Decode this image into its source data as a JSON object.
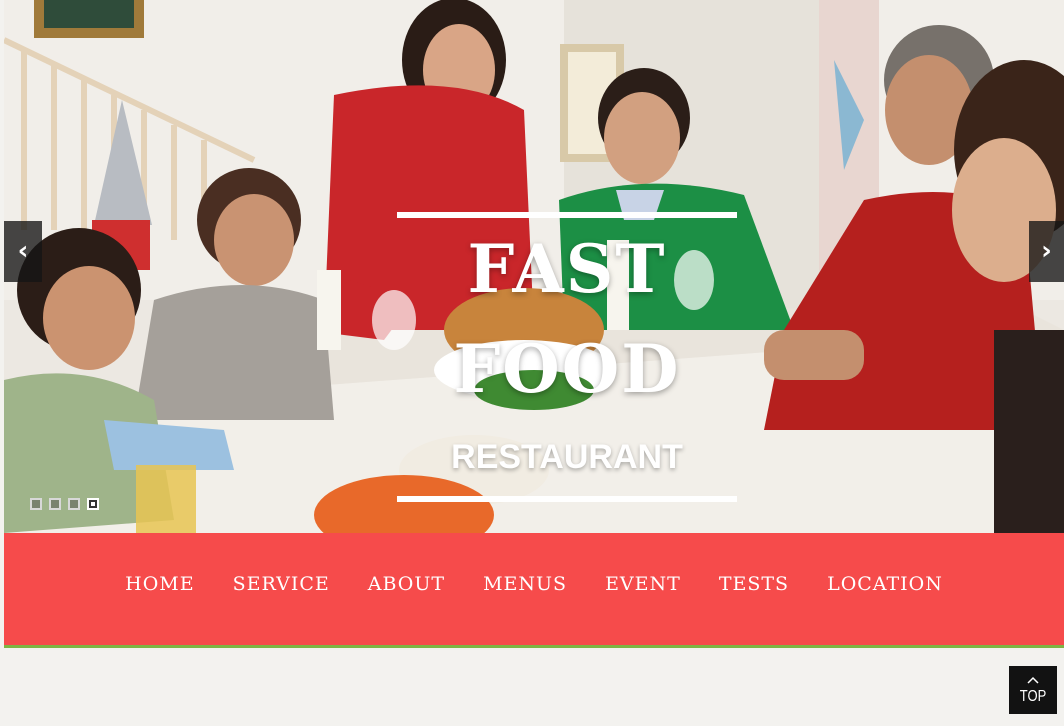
{
  "slider": {
    "title_line1": "FAST",
    "title_line2": "FOOD",
    "subtitle": "RESTAURANT",
    "prev_icon": "‹",
    "next_icon": "›",
    "slides_total": 4,
    "active_slide": 4
  },
  "nav": {
    "items": [
      "HOME",
      "SERVICE",
      "ABOUT",
      "MENUS",
      "EVENT",
      "TESTS",
      "LOCATION"
    ]
  },
  "back_to_top": {
    "label": "TOP"
  },
  "colors": {
    "nav_bg": "#f64b4b",
    "nav_border": "#7eb444",
    "page_bg": "#f3f2ef",
    "top_button_bg": "#121212"
  }
}
